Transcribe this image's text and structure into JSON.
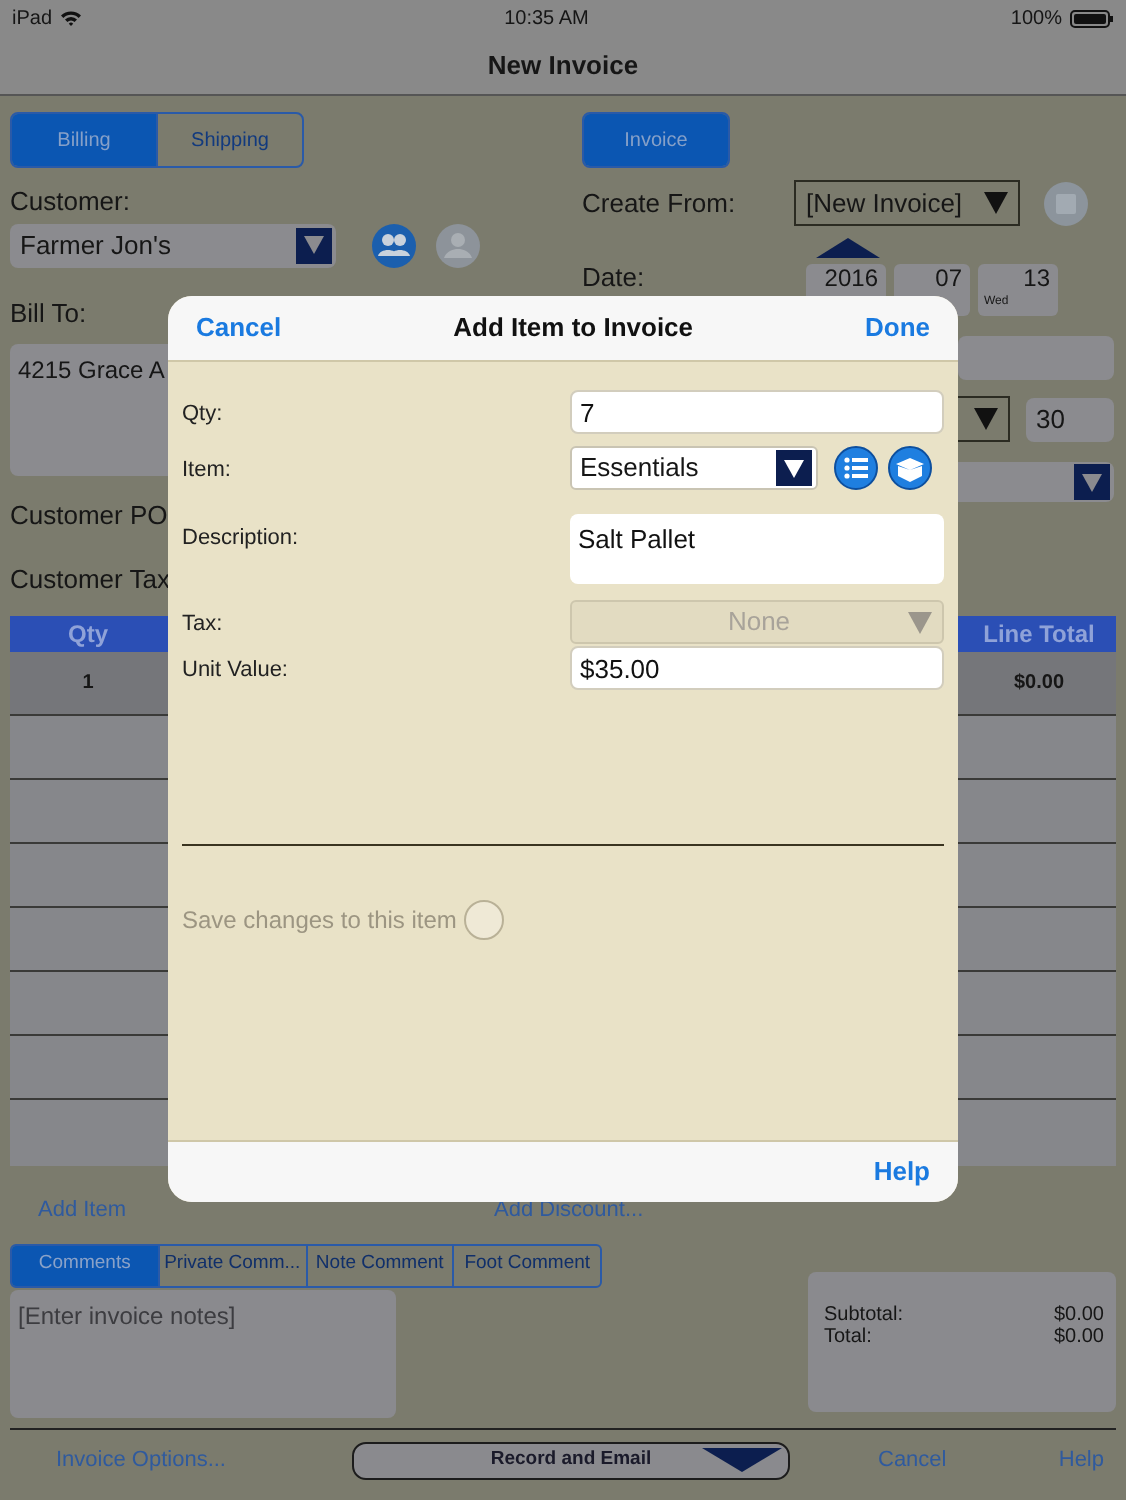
{
  "status_bar": {
    "device": "iPad",
    "time": "10:35 AM",
    "battery": "100%"
  },
  "nav_bar": {
    "title": "New Invoice"
  },
  "address_tabs": [
    {
      "label": "Billing",
      "selected": true
    },
    {
      "label": "Shipping",
      "selected": false
    }
  ],
  "document_tabs": [
    {
      "label": "Invoice",
      "selected": true
    }
  ],
  "customer": {
    "label": "Customer:",
    "value": "Farmer Jon's"
  },
  "bill_to": {
    "label": "Bill To:",
    "value": "4215 Grace A"
  },
  "customer_po": {
    "label": "Customer PO"
  },
  "customer_tax": {
    "label": "Customer Tax"
  },
  "create_from": {
    "label": "Create From:",
    "value": "[New Invoice]"
  },
  "date": {
    "label": "Date:",
    "year": "2016",
    "month": "07",
    "day": "13",
    "weekday": "Wed"
  },
  "terms": {
    "value": "30"
  },
  "table": {
    "columns": [
      "Qty",
      "Line Total"
    ],
    "rows": [
      {
        "qty": "1",
        "line_total": "$0.00"
      }
    ]
  },
  "item_links": [
    "Add Item",
    "Add Discount..."
  ],
  "comment_tabs": [
    {
      "label": "Comments",
      "selected": true
    },
    {
      "label": "Private Comm...",
      "selected": false
    },
    {
      "label": "Note Comment",
      "selected": false
    },
    {
      "label": "Foot Comment",
      "selected": false
    }
  ],
  "notes": {
    "placeholder": "[Enter invoice notes]"
  },
  "totals": [
    {
      "label": "Subtotal:",
      "value": "$0.00"
    },
    {
      "label": "Total:",
      "value": "$0.00"
    }
  ],
  "bottom_bar": {
    "options": "Invoice Options...",
    "record": "Record and Email",
    "cancel": "Cancel",
    "help": "Help"
  },
  "dialog": {
    "title": "Add Item to Invoice",
    "cancel": "Cancel",
    "done": "Done",
    "help": "Help",
    "fields": [
      {
        "kind": "text",
        "label": "Qty:",
        "value": "7",
        "disabled": false
      },
      {
        "kind": "select",
        "label": "Item:",
        "value": "Essentials",
        "disabled": false
      },
      {
        "kind": "textarea",
        "label": "Description:",
        "value": "Salt Pallet",
        "disabled": false
      },
      {
        "kind": "select",
        "label": "Tax:",
        "value": "None",
        "disabled": true
      },
      {
        "kind": "text",
        "label": "Unit Value:",
        "value": "$35.00",
        "disabled": false
      }
    ],
    "save_toggle": {
      "label": "Save changes to this item",
      "on": false,
      "disabled": true
    }
  }
}
